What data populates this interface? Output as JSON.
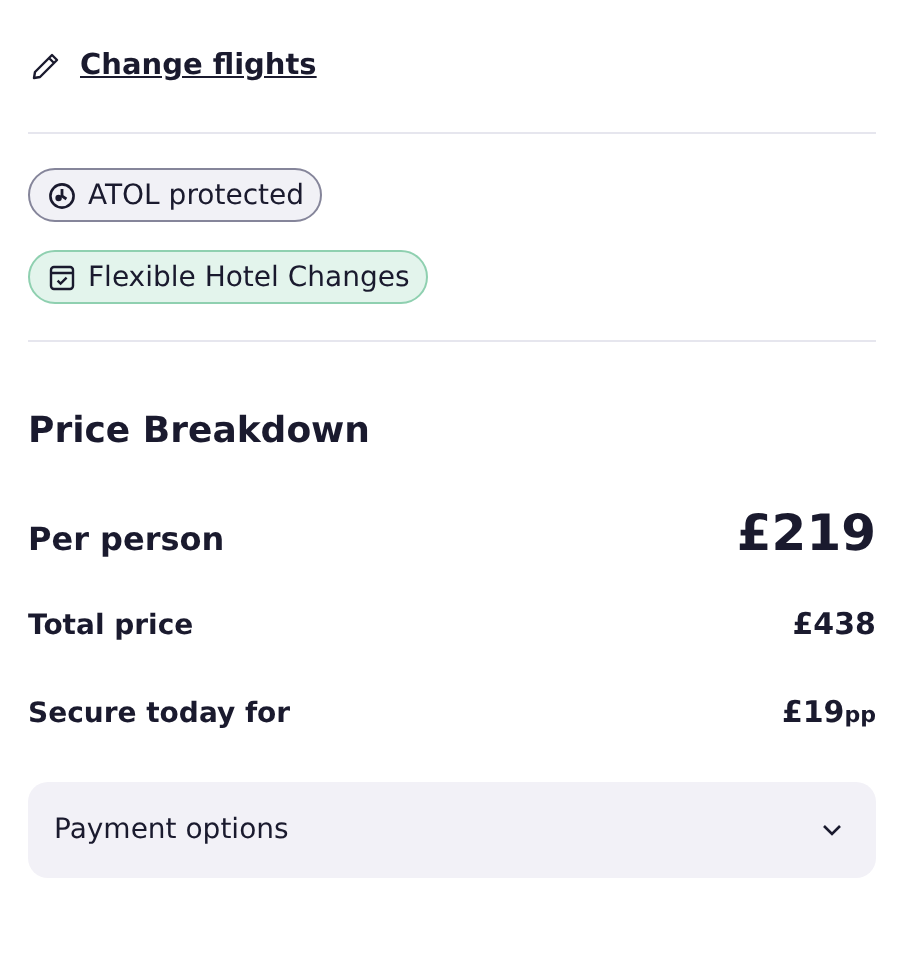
{
  "change_link": {
    "label": "Change flights"
  },
  "badges": [
    {
      "kind": "atol",
      "label": "ATOL protected"
    },
    {
      "kind": "flexible",
      "label": "Flexible Hotel Changes"
    }
  ],
  "price_breakdown": {
    "title": "Price Breakdown",
    "rows": [
      {
        "kind": "main",
        "label": "Per person",
        "value": "£219"
      },
      {
        "kind": "normal",
        "label": "Total price",
        "value": "£438"
      },
      {
        "kind": "normal",
        "label": "Secure today for",
        "value": "£19",
        "unit": "pp"
      }
    ]
  },
  "payment_options": {
    "label": "Payment options",
    "expanded": false
  }
}
